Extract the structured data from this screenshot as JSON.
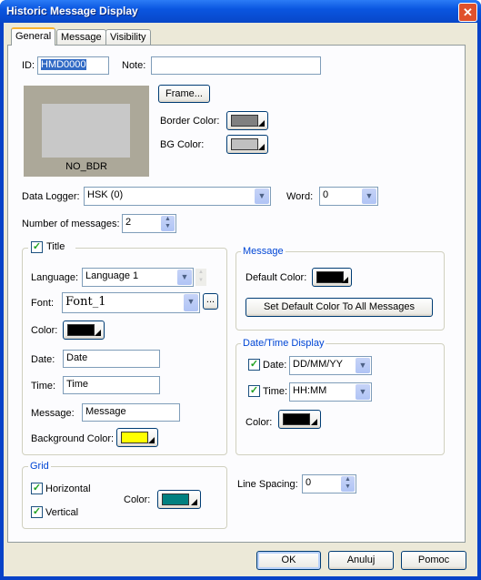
{
  "window": {
    "title": "Historic Message Display"
  },
  "tabs": [
    {
      "label": "General"
    },
    {
      "label": "Message"
    },
    {
      "label": "Visibility"
    }
  ],
  "general": {
    "id_label": "ID:",
    "id_value": "HMD0000",
    "note_label": "Note:",
    "note_value": "",
    "preview_text": "NO_BDR",
    "frame_button": "Frame...",
    "border_color_label": "Border Color:",
    "border_color": "#808080",
    "bg_color_label": "BG Color:",
    "bg_color": "#c0c0c0",
    "data_logger_label": "Data Logger:",
    "data_logger_value": "HSK (0)",
    "word_label": "Word:",
    "word_value": "0",
    "num_messages_label": "Number of messages:",
    "num_messages_value": "2"
  },
  "title_group": {
    "label": "Title",
    "checked": true,
    "language_label": "Language:",
    "language_value": "Language 1",
    "font_label": "Font:",
    "font_value": "Font_1",
    "font_more": "...",
    "color_label": "Color:",
    "color": "#000000",
    "date_label": "Date:",
    "date_value": "Date",
    "time_label": "Time:",
    "time_value": "Time",
    "message_label": "Message:",
    "message_value": "Message",
    "bg_color_label": "Background Color:",
    "bg_color": "#ffff00"
  },
  "message_group": {
    "label": "Message",
    "default_color_label": "Default Color:",
    "default_color": "#000000",
    "set_default_button": "Set Default Color To All Messages"
  },
  "datetime_group": {
    "label": "Date/Time Display",
    "date_label": "Date:",
    "date_checked": true,
    "date_format": "DD/MM/YY",
    "time_label": "Time:",
    "time_checked": true,
    "time_format": "HH:MM",
    "color_label": "Color:",
    "color": "#000000"
  },
  "grid_group": {
    "label": "Grid",
    "horizontal_label": "Horizontal",
    "horizontal_checked": true,
    "vertical_label": "Vertical",
    "vertical_checked": true,
    "color_label": "Color:",
    "color": "#008080"
  },
  "line_spacing": {
    "label": "Line Spacing:",
    "value": "0"
  },
  "buttons": {
    "ok": "OK",
    "cancel": "Anuluj",
    "help": "Pomoc"
  }
}
